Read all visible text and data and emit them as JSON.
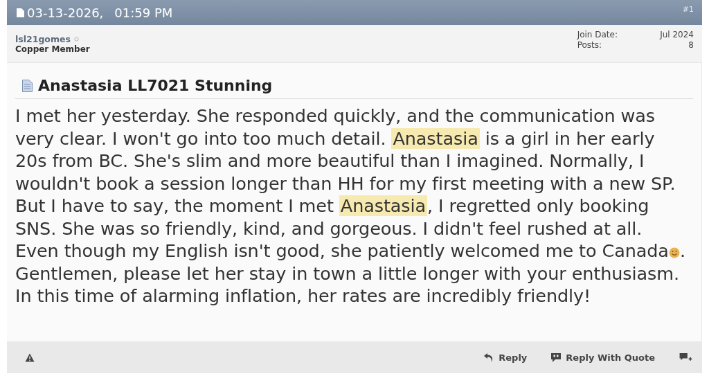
{
  "post_header": {
    "date": "03-13-2026,",
    "time": "01:59 PM",
    "number": "#1"
  },
  "author": {
    "username": "lsl21gomes",
    "online": false,
    "rank": "Copper Member",
    "stats": [
      {
        "label": "Join Date:",
        "value": "Jul 2024"
      },
      {
        "label": "Posts:",
        "value": "8"
      }
    ]
  },
  "post": {
    "title": "Anastasia LL7021 Stunning",
    "body": [
      {
        "kind": "text",
        "text": "I met her yesterday. She responded quickly, and the communication was\nvery clear. I won't go into too much detail. ",
        "highlighted": false
      },
      {
        "kind": "text",
        "text": "Anastasia",
        "highlighted": true
      },
      {
        "kind": "text",
        "text": " is a girl in her early\n20s from BC. She's slim and more beautiful than I imagined. Normally, I\nwouldn't book a session longer than HH for my first meeting with a new SP.\nBut I have to say, the moment I met ",
        "highlighted": false
      },
      {
        "kind": "text",
        "text": "Anastasia",
        "highlighted": true
      },
      {
        "kind": "text",
        "text": ", I regretted only booking\nSNS. She was so friendly, kind, and gorgeous. I didn't feel rushed at all.\nEven though my English isn't good, she patiently welcomed me to Canada",
        "highlighted": false
      },
      {
        "kind": "emoji"
      },
      {
        "kind": "text",
        "text": ".\nGentlemen, please let her stay in town a little longer with your enthusiasm.\nIn this time of alarming inflation, her rates are incredibly friendly!",
        "highlighted": false
      }
    ]
  },
  "footer": {
    "actions": [
      {
        "kind": "reply",
        "label": "Reply"
      },
      {
        "kind": "quote",
        "label": "Reply With Quote"
      },
      {
        "kind": "multiquote"
      }
    ]
  }
}
